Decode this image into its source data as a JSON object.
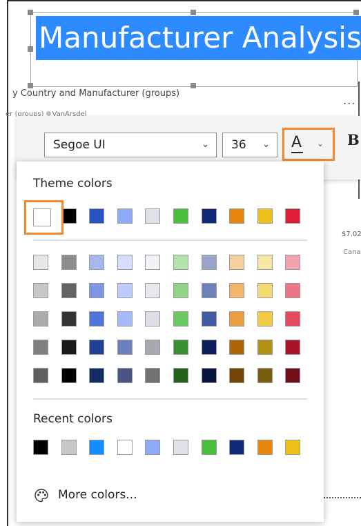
{
  "report": {
    "title": "Manufacturer Analysis",
    "chart_subtitle": "y Country and Manufacturer (groups)",
    "legend_fragment_left": "er (groups)",
    "legend_fragment_right": "VanArsdel",
    "ellipsis": "...",
    "bg_value_fragment": "$7.02",
    "bg_category_fragment": "Cana"
  },
  "toolbar": {
    "font_family": "Segoe UI",
    "font_size": "36",
    "font_color_glyph": "A",
    "bold_label": "B",
    "chevron": "⌄"
  },
  "color_picker": {
    "theme_label": "Theme colors",
    "recent_label": "Recent colors",
    "more_colors_label": "More colors...",
    "selected_color": "#FFFFFF",
    "accent_highlight": "#F7882F",
    "theme_colors": [
      "#FFFFFF",
      "#000000",
      "#2754C5",
      "#8FA9F9",
      "#DDE1E8",
      "#4BBF3B",
      "#0F287A",
      "#E8860B",
      "#EFBF1C",
      "#E01B35"
    ],
    "shade_rows": [
      [
        "#E6E6E6",
        "#8C8C8C",
        "#A9B8EA",
        "#D5DEFE",
        "#F0F2F5",
        "#B5E3AE",
        "#9AA6CC",
        "#F6CF9E",
        "#FAE6A4",
        "#F2A4AE"
      ],
      [
        "#C7C7C7",
        "#646464",
        "#7D96E2",
        "#BDCBFC",
        "#E6E8ED",
        "#91D488",
        "#6E81B8",
        "#F1B56C",
        "#F5D870",
        "#EC7688"
      ],
      [
        "#ABABAB",
        "#333333",
        "#5074DA",
        "#A4B8FB",
        "#DCE0E6",
        "#6CC860",
        "#405BA1",
        "#EC9D3D",
        "#F2CB44",
        "#E64A61"
      ],
      [
        "#7F7F7F",
        "#1A1A1A",
        "#1E3F94",
        "#6B80BE",
        "#A6A9AE",
        "#389030",
        "#0B1E5C",
        "#AE6508",
        "#B38F15",
        "#A81428"
      ],
      [
        "#5E5E5E",
        "#000000",
        "#142A62",
        "#475580",
        "#6F7174",
        "#25601F",
        "#07143D",
        "#744306",
        "#775F0E",
        "#700D1B"
      ]
    ],
    "recent_colors": [
      "#000000",
      "#C8C8C8",
      "#118DFF",
      "#FFFFFF",
      "#8FA9F9",
      "#DDE1E8",
      "#4BBF3B",
      "#0F287A",
      "#E8860B",
      "#EFBF1C"
    ]
  }
}
